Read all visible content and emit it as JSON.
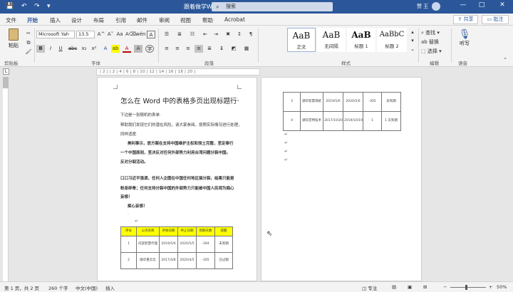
{
  "titlebar": {
    "doc_title": "跟着做学Word",
    "search_placeholder": "搜索",
    "user": "赞 王",
    "qa_save": "💾",
    "qa_undo": "↶",
    "qa_redo": "↷",
    "qa_more": "▾",
    "min": "—",
    "max": "□",
    "close": "✕"
  },
  "tabs": [
    "文件",
    "开始",
    "插入",
    "设计",
    "布局",
    "引用",
    "邮件",
    "审阅",
    "视图",
    "帮助",
    "Acrobat"
  ],
  "share_label": "共享",
  "comment_label": "批注",
  "ribbon": {
    "paste_label": "粘贴",
    "clipboard_label": "剪贴板",
    "font_name": "Microsoft Yah",
    "font_size": "13.5",
    "font_group_label": "字体",
    "paragraph_label": "段落",
    "styles_label": "样式",
    "editing_label": "编辑",
    "voice_label": "语音",
    "bold": "B",
    "italic": "I",
    "underline": "U",
    "strike": "abc",
    "sub": "x₂",
    "sup": "x²",
    "grow": "A^",
    "shrink": "A˅",
    "case": "Aa",
    "clear": "A⌫",
    "wen": "wén",
    "charborder": "A",
    "highlight": "ab",
    "fontcolor": "A",
    "charshade": "A",
    "encircle": "字",
    "dictate_label": "听写",
    "find_label": "查找",
    "replace_label": "替换",
    "select_label": "选择",
    "styles": [
      {
        "sample": "AaB",
        "name": "正文"
      },
      {
        "sample": "AaB",
        "name": "无间隔"
      },
      {
        "sample": "AaB",
        "name": "标题 1"
      },
      {
        "sample": "AaBbC",
        "name": "标题 2"
      }
    ]
  },
  "ruler_marks": "| 2 |    | 2 | 4 | 6 | 8 | 10 | 12 | 14 | 16 | 18 | 20 |",
  "page1": {
    "heading": "怎么在 Word 中的表格多页出现标题行·",
    "paras": [
      "下边是一张随机的表单·",
      "帮助我们发现它们的潜在风险，请大家参阅，按照实际情况进行处理，",
      "同样适度·",
      "美利事示，居方案在支持中国维护主权和领土完整，坚定奉行",
      "一个中国原则，坚决反对任何外部势力利用台湾问题分裂中国。",
      "反对分裂活动。",
      "口口习近平强调，任何人企图在中国任何地区搞分裂，结果只能是",
      "粉身碎骨；任何支持分裂中国的外部势力只能被中国人民视为痴心",
      "妄想！",
      "痴心妄想！"
    ],
    "table": {
      "headers": [
        "序号",
        "公司名称",
        "开始日期",
        "终止日期",
        "到期天数",
        "提醒"
      ],
      "rows": [
        [
          "1",
          "问案智慧代理",
          "2019/5/6",
          "2020/5/5",
          "-304",
          "未到期"
        ],
        [
          "2",
          "顺华重云云",
          "2017/4/8",
          "2020/4/5",
          "-305",
          "已过期"
        ]
      ]
    }
  },
  "page2": {
    "table": {
      "rows": [
        [
          "3",
          "湖华智慧海统",
          "2019/5/6",
          "2020/5/6",
          "-305",
          "未到期"
        ],
        [
          "4",
          "湖华宏特技术",
          "2017/10/20",
          "2019/10/19",
          "1",
          "1 天到期"
        ]
      ]
    }
  },
  "status": {
    "page": "第 1 页，共 2 页",
    "words": "260 个字",
    "lang": "中文(中国)",
    "mode": "插入",
    "focus": "专注",
    "zoom": "50%",
    "zoom_minus": "−",
    "zoom_plus": "+"
  }
}
